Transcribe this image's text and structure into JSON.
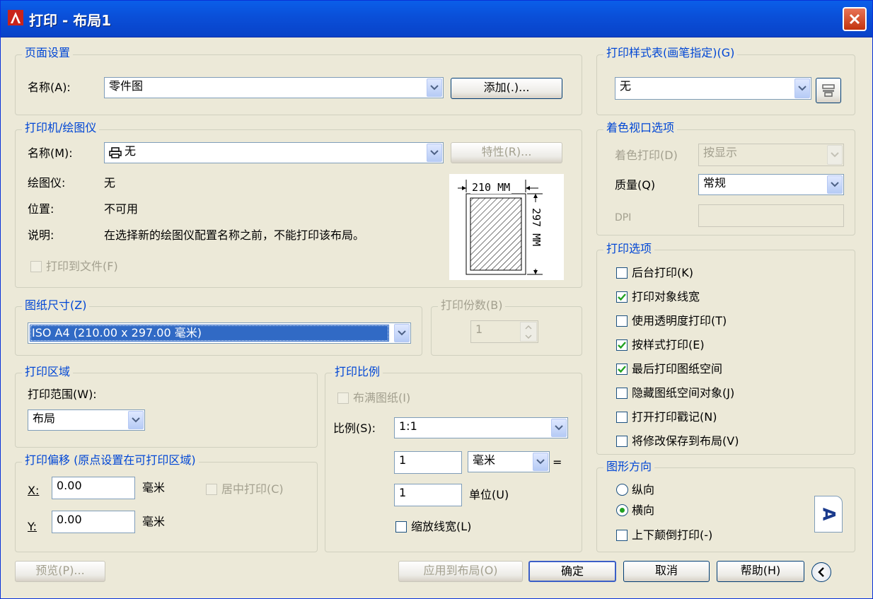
{
  "title": "打印 - 布局1",
  "page_setup": {
    "legend": "页面设置",
    "name_label": "名称(A):",
    "name_value": "零件图",
    "add_button": "添加(.)..."
  },
  "printer": {
    "legend": "打印机/绘图仪",
    "name_label": "名称(M):",
    "name_value": "无",
    "properties_button": "特性(R)...",
    "plotter_label": "绘图仪:",
    "plotter_value": "无",
    "location_label": "位置:",
    "location_value": "不可用",
    "desc_label": "说明:",
    "desc_value": "在选择新的绘图仪配置名称之前，不能打印该布局。",
    "print_to_file": "打印到文件(F)",
    "preview_width": "210 MM",
    "preview_height": "297 MM"
  },
  "paper_size": {
    "legend": "图纸尺寸(Z)",
    "value": "ISO A4 (210.00 x 297.00 毫米)"
  },
  "copies": {
    "legend": "打印份数(B)",
    "value": "1"
  },
  "plot_area": {
    "legend": "打印区域",
    "range_label": "打印范围(W):",
    "range_value": "布局"
  },
  "plot_offset": {
    "legend": "打印偏移 (原点设置在可打印区域)",
    "x_label": "X:",
    "x_value": "0.00",
    "x_unit": "毫米",
    "y_label": "Y:",
    "y_value": "0.00",
    "y_unit": "毫米",
    "center": "居中打印(C)"
  },
  "plot_scale": {
    "legend": "打印比例",
    "fit": "布满图纸(I)",
    "scale_label": "比例(S):",
    "scale_value": "1:1",
    "num1": "1",
    "unit1": "毫米",
    "equals": "=",
    "num2": "1",
    "unit2": "单位(U)",
    "scale_lineweights": "缩放线宽(L)"
  },
  "style_table": {
    "legend": "打印样式表(画笔指定)(G)",
    "value": "无"
  },
  "shaded": {
    "legend": "着色视口选项",
    "shade_label": "着色打印(D)",
    "shade_value": "按显示",
    "quality_label": "质量(Q)",
    "quality_value": "常规",
    "dpi_label": "DPI",
    "dpi_value": ""
  },
  "options": {
    "legend": "打印选项",
    "items": [
      {
        "label": "后台打印(K)",
        "checked": false
      },
      {
        "label": "打印对象线宽",
        "checked": true
      },
      {
        "label": "使用透明度打印(T)",
        "checked": false
      },
      {
        "label": "按样式打印(E)",
        "checked": true
      },
      {
        "label": "最后打印图纸空间",
        "checked": true
      },
      {
        "label": "隐藏图纸空间对象(J)",
        "checked": false
      },
      {
        "label": "打开打印戳记(N)",
        "checked": false
      },
      {
        "label": "将修改保存到布局(V)",
        "checked": false
      }
    ]
  },
  "orientation": {
    "legend": "图形方向",
    "portrait": "纵向",
    "landscape": "横向",
    "upside_down": "上下颠倒打印(-)",
    "icon_letter": "A"
  },
  "footer": {
    "preview": "预览(P)...",
    "apply": "应用到布局(O)",
    "ok": "确定",
    "cancel": "取消",
    "help": "帮助(H)"
  },
  "colors": {
    "title_bar": "#0a5ee9",
    "group_label": "#0046d5",
    "selection": "#316ac5",
    "check": "#21a121"
  }
}
